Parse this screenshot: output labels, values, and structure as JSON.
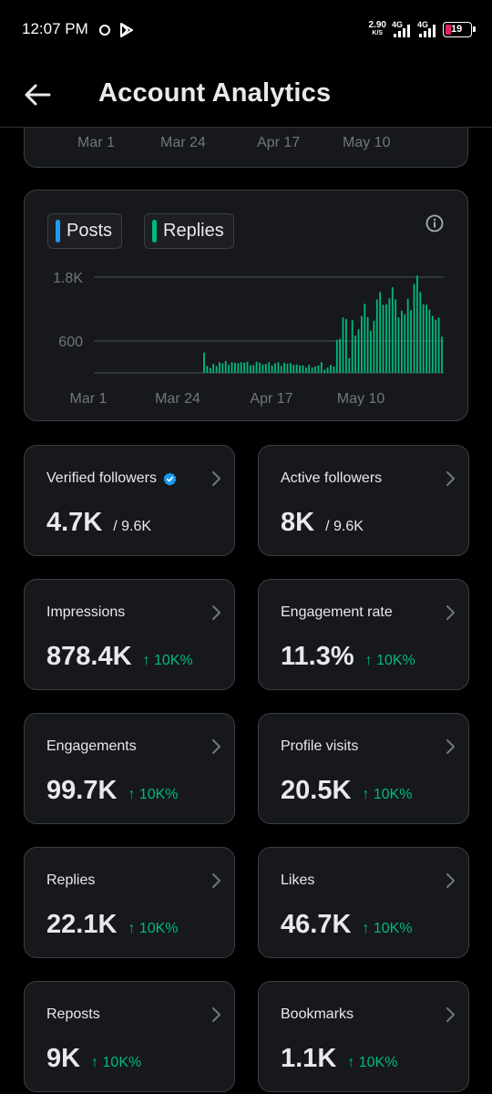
{
  "status_bar": {
    "time": "12:07 PM",
    "speed_value": "2.90",
    "speed_unit": "K/S",
    "net1": "4G",
    "net2": "4G",
    "battery": "19"
  },
  "header": {
    "title": "Account Analytics"
  },
  "previous_chart": {
    "x_ticks": [
      "Mar 1",
      "Mar 24",
      "Apr 17",
      "May 10"
    ]
  },
  "chart_data": {
    "type": "bar",
    "legend": [
      {
        "label": "Posts",
        "color": "#1d9bf0"
      },
      {
        "label": "Replies",
        "color": "#00ba7c"
      }
    ],
    "y_ticks": [
      "1.8K",
      "600"
    ],
    "y_tick_values": [
      1800,
      600
    ],
    "x_ticks": [
      "Mar 1",
      "Mar 24",
      "Apr 17",
      "May 10"
    ],
    "ylim": [
      0,
      1900
    ],
    "grid": true,
    "series": [
      {
        "name": "Replies",
        "color": "#00ba7c",
        "values": [
          380,
          130,
          90,
          170,
          130,
          200,
          180,
          220,
          150,
          200,
          190,
          180,
          200,
          190,
          210,
          140,
          150,
          210,
          190,
          160,
          170,
          200,
          140,
          180,
          200,
          130,
          190,
          170,
          180,
          150,
          160,
          140,
          140,
          100,
          150,
          100,
          120,
          140,
          200,
          60,
          100,
          150,
          120,
          620,
          640,
          1040,
          1010,
          280,
          990,
          700,
          820,
          1070,
          1300,
          1050,
          790,
          980,
          1380,
          1520,
          1280,
          1290,
          1400,
          1610,
          1380,
          1040,
          1170,
          1100,
          1390,
          1180,
          1670,
          1830,
          1520,
          1290,
          1280,
          1190,
          1070,
          1000,
          1040,
          680
        ]
      }
    ]
  },
  "stats": [
    {
      "label": "Verified followers",
      "verified": true,
      "value": "4.7K",
      "sub": "/ 9.6K",
      "delta": ""
    },
    {
      "label": "Active followers",
      "verified": false,
      "value": "8K",
      "sub": "/ 9.6K",
      "delta": ""
    },
    {
      "label": "Impressions",
      "verified": false,
      "value": "878.4K",
      "sub": "",
      "delta": "↑ 10K%"
    },
    {
      "label": "Engagement rate",
      "verified": false,
      "value": "11.3%",
      "sub": "",
      "delta": "↑ 10K%"
    },
    {
      "label": "Engagements",
      "verified": false,
      "value": "99.7K",
      "sub": "",
      "delta": "↑ 10K%"
    },
    {
      "label": "Profile visits",
      "verified": false,
      "value": "20.5K",
      "sub": "",
      "delta": "↑ 10K%"
    },
    {
      "label": "Replies",
      "verified": false,
      "value": "22.1K",
      "sub": "",
      "delta": "↑ 10K%"
    },
    {
      "label": "Likes",
      "verified": false,
      "value": "46.7K",
      "sub": "",
      "delta": "↑ 10K%"
    },
    {
      "label": "Reposts",
      "verified": false,
      "value": "9K",
      "sub": "",
      "delta": "↑ 10K%"
    },
    {
      "label": "Bookmarks",
      "verified": false,
      "value": "1.1K",
      "sub": "",
      "delta": "↑ 10K%"
    }
  ]
}
